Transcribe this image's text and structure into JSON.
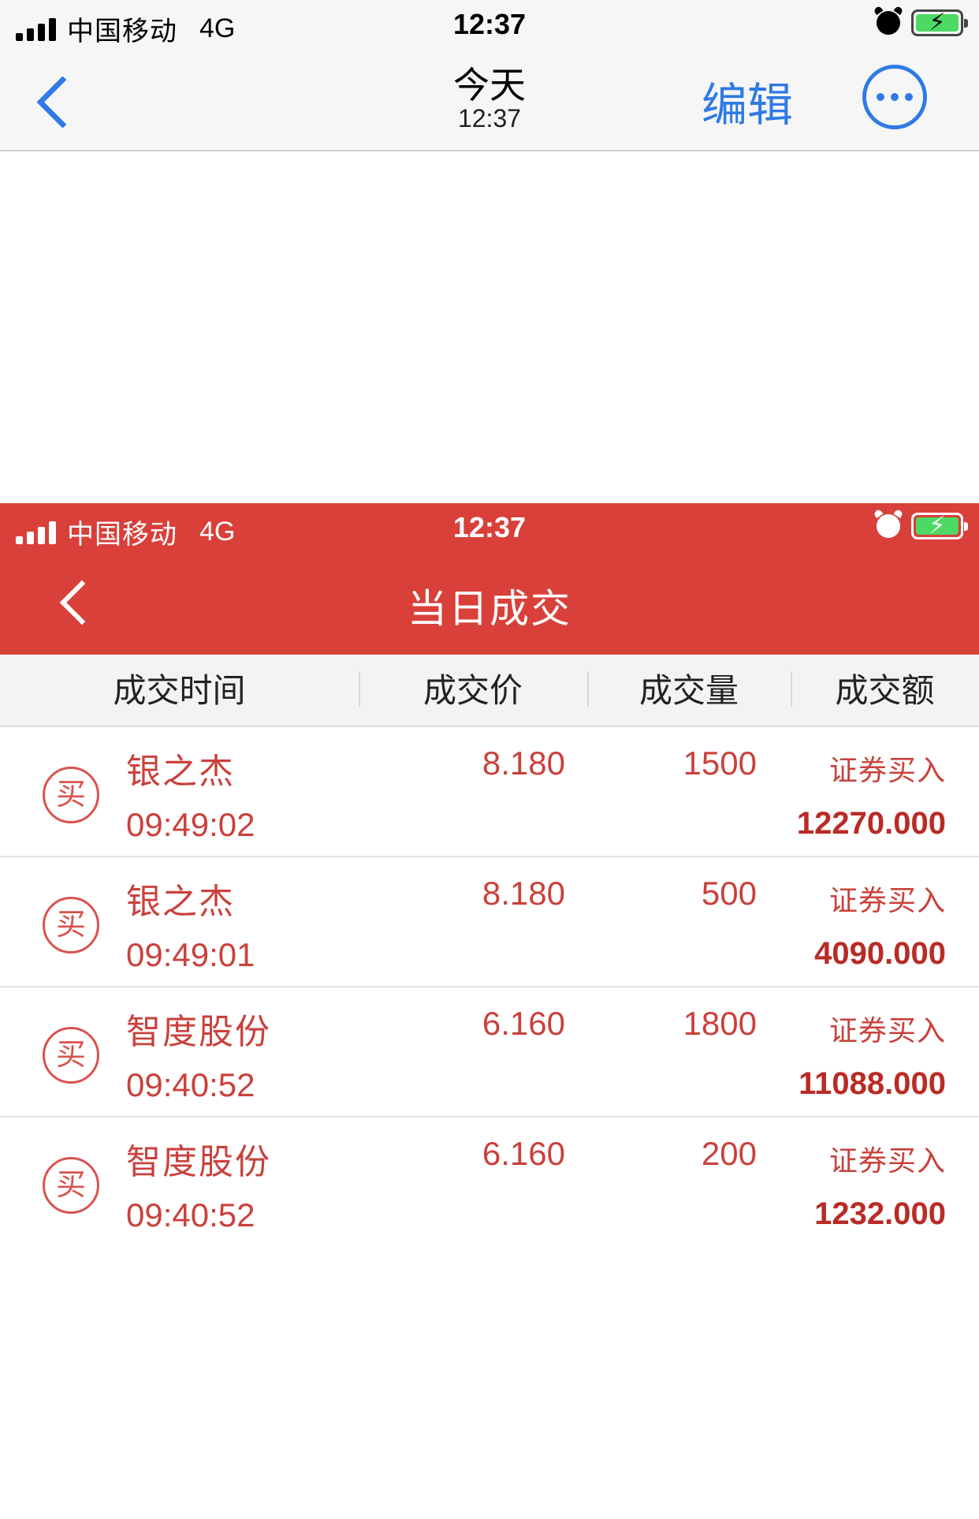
{
  "statusbar_top": {
    "carrier": "中国移动",
    "network": "4G",
    "time": "12:37"
  },
  "nav": {
    "title": "今天",
    "subtitle": "12:37",
    "edit_label": "编辑",
    "accent": "#2f7ae5"
  },
  "statusbar_app": {
    "carrier": "中国移动",
    "network": "4G",
    "time": "12:37"
  },
  "app": {
    "title": "当日成交",
    "brand_color": "#d9403a",
    "columns": [
      "成交时间",
      "成交价",
      "成交量",
      "成交额"
    ],
    "rows": [
      {
        "badge": "买",
        "name": "银之杰",
        "time": "09:49:02",
        "price": "8.180",
        "volume": "1500",
        "type": "证券买入",
        "amount": "12270.000"
      },
      {
        "badge": "买",
        "name": "银之杰",
        "time": "09:49:01",
        "price": "8.180",
        "volume": "500",
        "type": "证券买入",
        "amount": "4090.000"
      },
      {
        "badge": "买",
        "name": "智度股份",
        "time": "09:40:52",
        "price": "6.160",
        "volume": "1800",
        "type": "证券买入",
        "amount": "11088.000"
      },
      {
        "badge": "买",
        "name": "智度股份",
        "time": "09:40:52",
        "price": "6.160",
        "volume": "200",
        "type": "证券买入",
        "amount": "1232.000"
      }
    ]
  }
}
